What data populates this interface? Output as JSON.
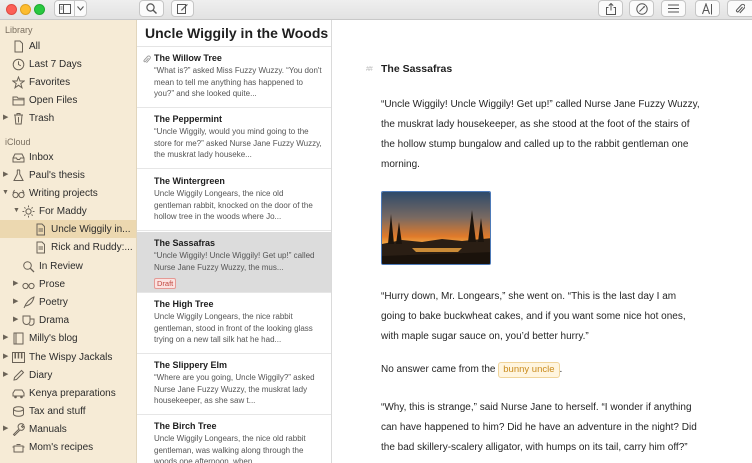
{
  "sidebar": {
    "library_title": "Library",
    "library": [
      {
        "label": "All",
        "icon": "document-icon"
      },
      {
        "label": "Last 7 Days",
        "icon": "clock-icon"
      },
      {
        "label": "Favorites",
        "icon": "star-icon"
      },
      {
        "label": "Open Files",
        "icon": "folder-icon"
      },
      {
        "label": "Trash",
        "icon": "trash-icon"
      }
    ],
    "icloud_title": "iCloud",
    "icloud": [
      {
        "label": "Inbox",
        "icon": "inbox-icon"
      },
      {
        "label": "Paul's thesis",
        "icon": "flask-icon"
      },
      {
        "label": "Writing projects",
        "icon": "glasses-icon"
      },
      {
        "label": "For Maddy",
        "icon": "sun-icon"
      },
      {
        "label": "Uncle Wiggily in...",
        "icon": "document-icon"
      },
      {
        "label": "Rick and Ruddy:...",
        "icon": "document-icon"
      },
      {
        "label": "In Review",
        "icon": "magnifier-icon"
      },
      {
        "label": "Prose",
        "icon": "glasses-icon"
      },
      {
        "label": "Poetry",
        "icon": "quill-icon"
      },
      {
        "label": "Drama",
        "icon": "mask-icon"
      },
      {
        "label": "Milly's blog",
        "icon": "notebook-icon"
      },
      {
        "label": "The Wispy Jackals",
        "icon": "piano-icon"
      },
      {
        "label": "Diary",
        "icon": "pencil-icon"
      },
      {
        "label": "Kenya preparations",
        "icon": "car-icon"
      },
      {
        "label": "Tax and stuff",
        "icon": "coins-icon"
      },
      {
        "label": "Manuals",
        "icon": "wrench-icon"
      },
      {
        "label": "Mom's recipes",
        "icon": "pot-icon"
      }
    ]
  },
  "notelist": {
    "header": "Uncle Wiggily in the Woods",
    "notes": [
      {
        "title": "The Willow Tree",
        "snippet": "“What is?” asked Miss Fuzzy Wuzzy. “You don't mean to tell me anything has happened to you?” and she looked quite..."
      },
      {
        "title": "The Peppermint",
        "snippet": "“Uncle Wiggily, would you mind going to the store for me?” asked Nurse Jane Fuzzy Wuzzy, the muskrat lady houseke..."
      },
      {
        "title": "The Wintergreen",
        "snippet": "Uncle Wiggily Longears, the nice old gentleman rabbit, knocked on the door of the hollow tree in the woods where Jo..."
      },
      {
        "title": "The Sassafras",
        "snippet": "“Uncle Wiggily! Uncle Wiggily! Get up!” called Nurse Jane Fuzzy Wuzzy, the mus...",
        "badge": "Draft"
      },
      {
        "title": "The High Tree",
        "snippet": "Uncle Wiggily Longears, the nice rabbit gentleman, stood in front of the looking glass trying on a new tall silk hat he had..."
      },
      {
        "title": "The Slippery Elm",
        "snippet": "“Where are you going, Uncle Wiggily?” asked Nurse Jane Fuzzy Wuzzy, the muskrat lady housekeeper, as she saw t..."
      },
      {
        "title": "The Birch Tree",
        "snippet": "Uncle Wiggily Longears, the nice old rabbit gentleman, was walking along through the woods one afternoon, when..."
      }
    ]
  },
  "editor": {
    "heading_marker": "##",
    "title": "The Sassafras",
    "para1": "“Uncle Wiggily! Uncle Wiggily! Get up!” called Nurse Jane Fuzzy Wuzzy, the muskrat lady housekeeper, as she stood at the foot of the stairs of the hollow stump bungalow and called up to the rabbit gentleman one morning.",
    "para2": "“Hurry down, Mr. Longears,” she went on. “This is the last day I am going to bake buckwheat cakes, and if you want some nice hot ones, with maple sugar sauce on, you’d better hurry.”",
    "para3_before": "No answer came from the ",
    "para3_tag": "bunny uncle",
    "para3_after": ".",
    "para4": "“Why, this is strange,” said Nurse Jane to herself. “I wonder if anything can have happened to him? Did he have an adventure in the night? Did the bad skillery-scalery alligator, with humps on its tail, carry him off?”"
  },
  "colors": {
    "sidebar_bg": "#f6ebd6",
    "selected_sidebar": "#ecd8b0",
    "selected_note": "#dcdcdc",
    "tag": "#c98b1e",
    "draft": "#c0463f"
  }
}
